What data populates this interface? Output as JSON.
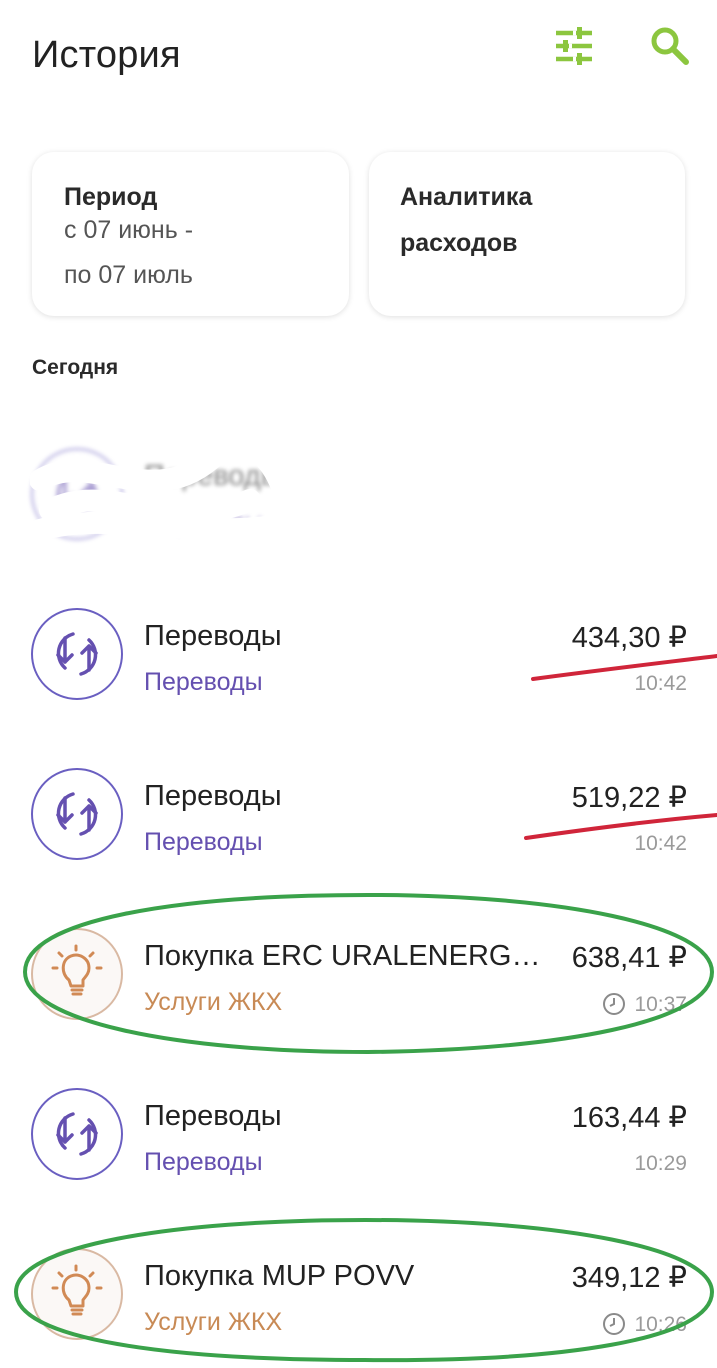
{
  "header": {
    "title": "История",
    "filter_icon": "sliders-icon",
    "search_icon": "search-icon",
    "accent_color": "#8cc63f"
  },
  "cards": {
    "period": {
      "title": "Период",
      "line1": "с 07 июнь -",
      "line2": "по 07 июль"
    },
    "analytics": {
      "title_line1": "Аналитика",
      "title_line2": "расходов"
    }
  },
  "section": {
    "label": "Сегодня"
  },
  "transactions": [
    {
      "title": "Переводы",
      "category": "Переводы",
      "amount": "",
      "time": "",
      "icon": "transfer-icon"
    },
    {
      "title": "Переводы",
      "category": "Переводы",
      "amount": "434,30 ₽",
      "time": "10:42",
      "icon": "transfer-icon"
    },
    {
      "title": "Переводы",
      "category": "Переводы",
      "amount": "519,22 ₽",
      "time": "10:42",
      "icon": "transfer-icon"
    },
    {
      "title": "Покупка ERC URALENERG…",
      "category": "Услуги ЖКХ",
      "amount": "638,41 ₽",
      "time": "10:37",
      "icon": "lightbulb-icon"
    },
    {
      "title": "Переводы",
      "category": "Переводы",
      "amount": "163,44 ₽",
      "time": "10:29",
      "icon": "transfer-icon"
    },
    {
      "title": "Покупка MUP POVV",
      "category": "Услуги ЖКХ",
      "amount": "349,12 ₽",
      "time": "10:26",
      "icon": "lightbulb-icon"
    }
  ],
  "colors": {
    "transfer": "#6550b0",
    "utility": "#c88a55",
    "annotation_red": "#d0253a",
    "annotation_green": "#3aa24a"
  }
}
